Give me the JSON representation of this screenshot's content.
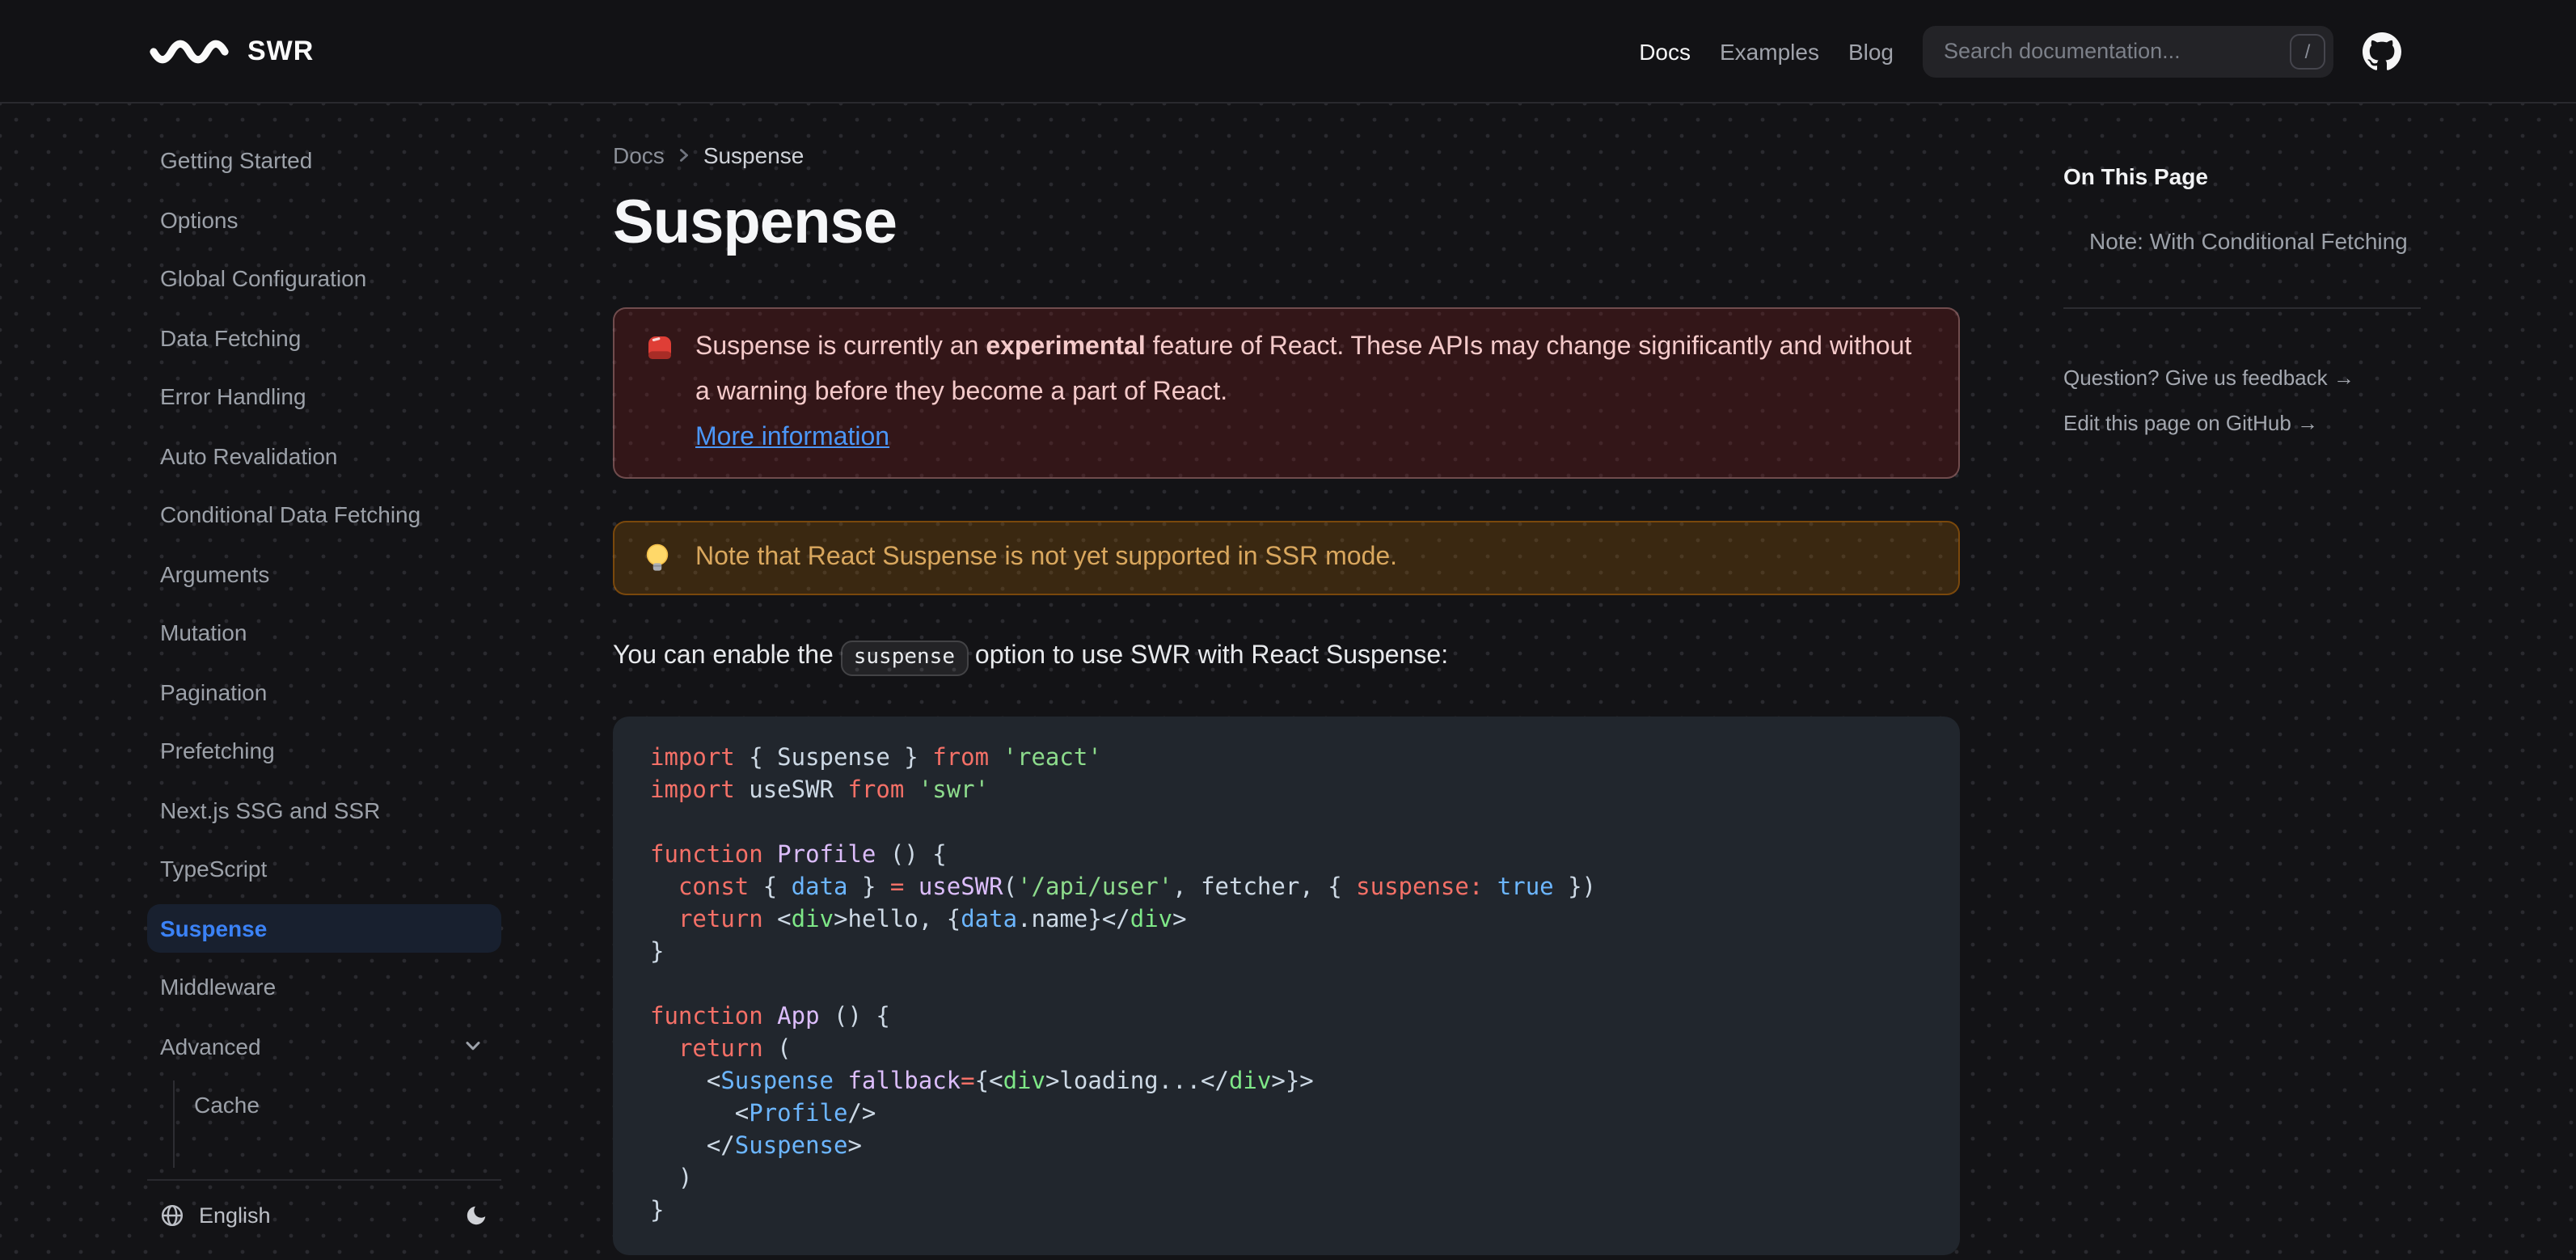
{
  "navbar": {
    "logo": "SWR",
    "links": [
      {
        "label": "Docs",
        "active": true
      },
      {
        "label": "Examples",
        "active": false
      },
      {
        "label": "Blog",
        "active": false
      }
    ],
    "search_placeholder": "Search documentation...",
    "search_kbd": "/"
  },
  "sidebar": {
    "items": [
      "Getting Started",
      "Options",
      "Global Configuration",
      "Data Fetching",
      "Error Handling",
      "Auto Revalidation",
      "Conditional Data Fetching",
      "Arguments",
      "Mutation",
      "Pagination",
      "Prefetching",
      "Next.js SSG and SSR",
      "TypeScript",
      "Suspense",
      "Middleware",
      "Advanced"
    ],
    "active_item": "Suspense",
    "expandable_item": "Advanced",
    "nested": [
      "Cache"
    ],
    "language": "English"
  },
  "breadcrumb": {
    "parent": "Docs",
    "current": "Suspense"
  },
  "content": {
    "title": "Suspense",
    "error_callout": {
      "icon": "siren-emoji",
      "before": "Suspense is currently an ",
      "bold": "experimental",
      "after": " feature of React. These APIs may change significantly and without a warning before they become a part of React.",
      "link": "More information"
    },
    "note_callout": {
      "icon": "bulb-emoji",
      "text": "Note that React Suspense is not yet supported in SSR mode."
    },
    "intro": {
      "before": "You can enable the ",
      "code": "suspense",
      "after": " option to use SWR with React Suspense:"
    },
    "code": {
      "token_colors": {
        "k": "#f47067",
        "p": "#cdd9e5",
        "s": "#8ddb8c",
        "f": "#dcbdfb",
        "v": "#6cb6ff",
        "g": "#7ee787"
      },
      "lines": [
        [
          {
            "t": "import",
            "c": "k"
          },
          {
            "t": " { Suspense } ",
            "c": "p"
          },
          {
            "t": "from",
            "c": "k"
          },
          {
            "t": " ",
            "c": "p"
          },
          {
            "t": "'react'",
            "c": "s"
          }
        ],
        [
          {
            "t": "import",
            "c": "k"
          },
          {
            "t": " useSWR ",
            "c": "p"
          },
          {
            "t": "from",
            "c": "k"
          },
          {
            "t": " ",
            "c": "p"
          },
          {
            "t": "'swr'",
            "c": "s"
          }
        ],
        [],
        [
          {
            "t": "function",
            "c": "k"
          },
          {
            "t": " ",
            "c": "p"
          },
          {
            "t": "Profile",
            "c": "f"
          },
          {
            "t": " () {",
            "c": "p"
          }
        ],
        [
          {
            "t": "  ",
            "c": "p"
          },
          {
            "t": "const",
            "c": "k"
          },
          {
            "t": " { ",
            "c": "p"
          },
          {
            "t": "data",
            "c": "v"
          },
          {
            "t": " } ",
            "c": "p"
          },
          {
            "t": "=",
            "c": "k"
          },
          {
            "t": " ",
            "c": "p"
          },
          {
            "t": "useSWR",
            "c": "f"
          },
          {
            "t": "(",
            "c": "p"
          },
          {
            "t": "'/api/user'",
            "c": "s"
          },
          {
            "t": ", fetcher, { ",
            "c": "p"
          },
          {
            "t": "suspense:",
            "c": "k"
          },
          {
            "t": " ",
            "c": "p"
          },
          {
            "t": "true",
            "c": "v"
          },
          {
            "t": " })",
            "c": "p"
          }
        ],
        [
          {
            "t": "  ",
            "c": "p"
          },
          {
            "t": "return",
            "c": "k"
          },
          {
            "t": " <",
            "c": "p"
          },
          {
            "t": "div",
            "c": "g"
          },
          {
            "t": ">hello, {",
            "c": "p"
          },
          {
            "t": "data",
            "c": "v"
          },
          {
            "t": ".name}</",
            "c": "p"
          },
          {
            "t": "div",
            "c": "g"
          },
          {
            "t": ">",
            "c": "p"
          }
        ],
        [
          {
            "t": "}",
            "c": "p"
          }
        ],
        [],
        [
          {
            "t": "function",
            "c": "k"
          },
          {
            "t": " ",
            "c": "p"
          },
          {
            "t": "App",
            "c": "f"
          },
          {
            "t": " () {",
            "c": "p"
          }
        ],
        [
          {
            "t": "  ",
            "c": "p"
          },
          {
            "t": "return",
            "c": "k"
          },
          {
            "t": " (",
            "c": "p"
          }
        ],
        [
          {
            "t": "    <",
            "c": "p"
          },
          {
            "t": "Suspense",
            "c": "v"
          },
          {
            "t": " ",
            "c": "p"
          },
          {
            "t": "fallback",
            "c": "f"
          },
          {
            "t": "=",
            "c": "k"
          },
          {
            "t": "{<",
            "c": "p"
          },
          {
            "t": "div",
            "c": "g"
          },
          {
            "t": ">loading...</",
            "c": "p"
          },
          {
            "t": "div",
            "c": "g"
          },
          {
            "t": ">}>",
            "c": "p"
          }
        ],
        [
          {
            "t": "      <",
            "c": "p"
          },
          {
            "t": "Profile",
            "c": "v"
          },
          {
            "t": "/>",
            "c": "p"
          }
        ],
        [
          {
            "t": "    </",
            "c": "p"
          },
          {
            "t": "Suspense",
            "c": "v"
          },
          {
            "t": ">",
            "c": "p"
          }
        ],
        [
          {
            "t": "  )",
            "c": "p"
          }
        ],
        [
          {
            "t": "}",
            "c": "p"
          }
        ]
      ]
    }
  },
  "toc": {
    "heading": "On This Page",
    "items": [
      "Note: With Conditional Fetching"
    ],
    "footer_links": [
      "Question? Give us feedback →",
      "Edit this page on GitHub →"
    ]
  },
  "colors": {
    "accent_blue": "#3b82f6",
    "link_blue": "#4b96f7",
    "error_text": "#f4caca",
    "warning_text": "#d9a75e",
    "code_background": "#21262d"
  }
}
